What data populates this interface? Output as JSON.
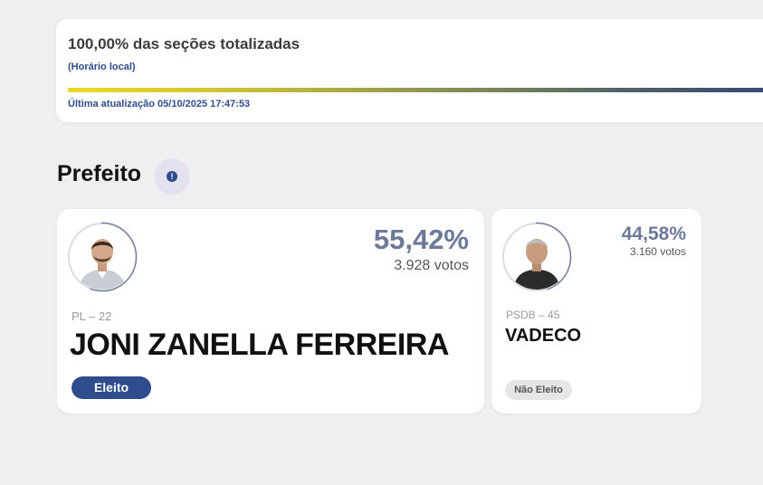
{
  "progress": {
    "title": "100,00% das seções totalizadas",
    "note": "(Horário local)",
    "percent": 100,
    "updated": "Última atualização 05/10/2025 17:47:53",
    "gradient_start": "#eed923",
    "gradient_end": "#334a74"
  },
  "section": {
    "title": "Prefeito",
    "info_icon": "info-icon"
  },
  "candidates": [
    {
      "percent": "55,42%",
      "vote_share": 55.42,
      "votes": "3.928 votos",
      "party": "PL – 22",
      "name": "JONI ZANELLA FERREIRA",
      "status": "Eleito",
      "status_color": "#2f4c8d"
    },
    {
      "percent": "44,58%",
      "vote_share": 44.58,
      "votes": "3.160 votos",
      "party": "PSDB – 45",
      "name": "VADECO",
      "status": "Não Eleito",
      "status_color": "#e6e6e6"
    }
  ],
  "colors": {
    "accent": "#2f4c8d",
    "percent_text": "#6c7a9a",
    "background": "#efeff1"
  }
}
